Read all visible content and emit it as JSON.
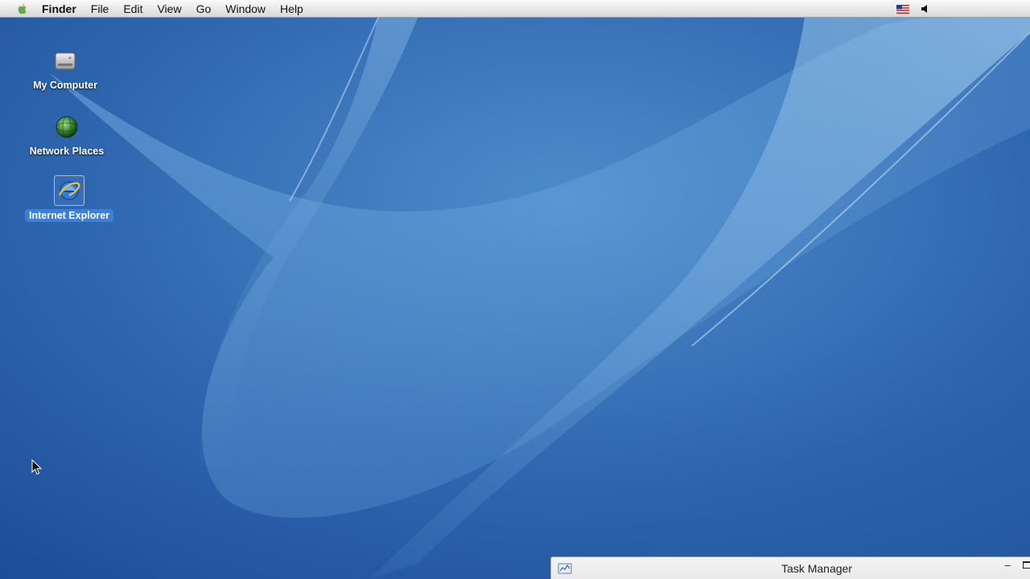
{
  "menubar": {
    "apple_icon": "apple-logo-icon",
    "app_name": "Finder",
    "menus": [
      "File",
      "Edit",
      "View",
      "Go",
      "Window",
      "Help"
    ],
    "status_icons": [
      "us-flag-icon",
      "volume-icon"
    ]
  },
  "desktop": {
    "wallpaper": "blue-aqua-waves",
    "icons": [
      {
        "label": "My Computer",
        "icon": "hard-drive-icon",
        "selected": false
      },
      {
        "label": "Network Places",
        "icon": "network-globe-icon",
        "selected": false
      },
      {
        "label": "Internet Explorer",
        "icon": "internet-explorer-icon",
        "selected": true
      }
    ]
  },
  "task_manager": {
    "title": "Task Manager",
    "icon": "task-manager-icon",
    "controls": [
      "minimize-icon",
      "maximize-icon"
    ]
  },
  "colors": {
    "wallpaper_dark": "#1d4f9a",
    "wallpaper_light": "#6aa6dc",
    "selection": "#3d7fd6"
  }
}
